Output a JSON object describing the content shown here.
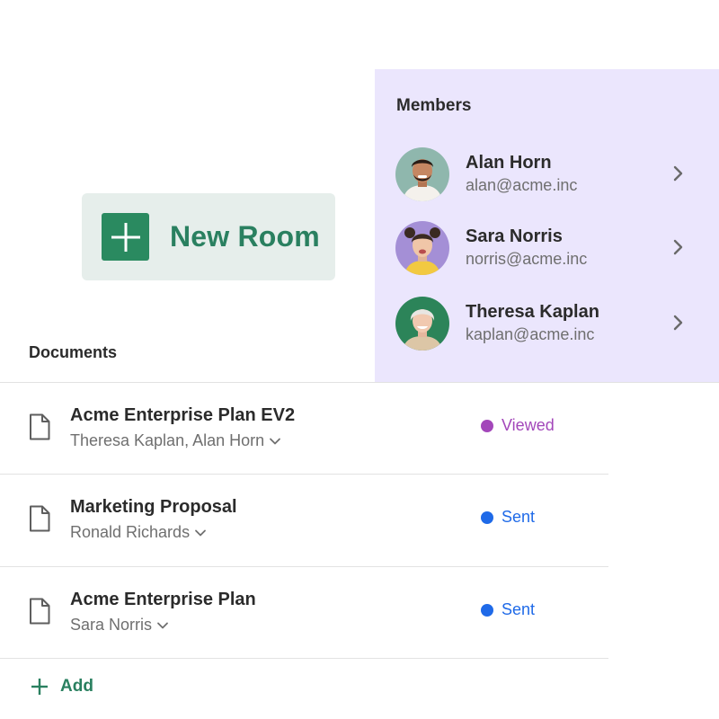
{
  "new_room": {
    "label": "New Room",
    "icon": "plus-icon"
  },
  "members": {
    "title": "Members",
    "items": [
      {
        "name": "Alan Horn",
        "email": "alan@acme.inc"
      },
      {
        "name": "Sara Norris",
        "email": "norris@acme.inc"
      },
      {
        "name": "Theresa Kaplan",
        "email": "kaplan@acme.inc"
      }
    ]
  },
  "documents": {
    "heading": "Documents",
    "items": [
      {
        "title": "Acme Enterprise Plan EV2",
        "people": "Theresa Kaplan, Alan Horn",
        "status": "Viewed",
        "status_color": "#a347ba"
      },
      {
        "title": "Marketing Proposal",
        "people": "Ronald Richards",
        "status": "Sent",
        "status_color": "#1f6ae8"
      },
      {
        "title": "Acme Enterprise Plan",
        "people": "Sara Norris",
        "status": "Sent",
        "status_color": "#1f6ae8"
      }
    ],
    "add_label": "Add"
  },
  "colors": {
    "accent_green": "#2a8060",
    "members_bg": "#ebe6fd",
    "new_room_bg": "#e6eeeb"
  }
}
